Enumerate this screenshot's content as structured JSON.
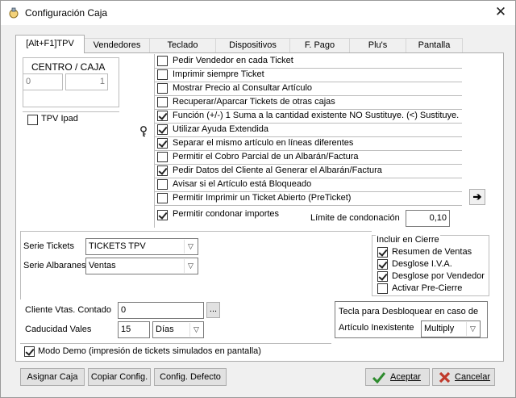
{
  "window": {
    "title": "Configuración Caja",
    "close_glyph": "✕"
  },
  "tabs": [
    "[Alt+F1]TPV",
    "Vendedores",
    "Teclado",
    "Dispositivos",
    "F. Pago",
    "Plu's",
    "Pantalla"
  ],
  "centro_caja": {
    "label": "CENTRO / CAJA",
    "centro_value": "0",
    "caja_value": "1"
  },
  "tpv_ipad": {
    "label": "TPV Ipad",
    "checked": false
  },
  "help_icon": "key-help-icon",
  "options": [
    {
      "label": "Pedir Vendedor en cada Ticket",
      "checked": false
    },
    {
      "label": "Imprimir siempre Ticket",
      "checked": false
    },
    {
      "label": "Mostrar Precio al Consultar Artículo",
      "checked": false
    },
    {
      "label": "Recuperar/Aparcar Tickets de otras cajas",
      "checked": false
    },
    {
      "label": "Función (+/-) 1 Suma a la cantidad existente NO Sustituye. (<) Sustituye.",
      "checked": true
    },
    {
      "label": "Utilizar Ayuda Extendida",
      "checked": true
    },
    {
      "label": "Separar el mismo artículo en líneas diferentes",
      "checked": true
    },
    {
      "label": "Permitir el Cobro Parcial de un Albarán/Factura",
      "checked": false
    },
    {
      "label": "Pedir Datos del Cliente al Generar el Albarán/Factura",
      "checked": true
    },
    {
      "label": "Avisar si el Artículo está Bloqueado",
      "checked": false
    },
    {
      "label": "Permitir Imprimir un Ticket Abierto (PreTicket)",
      "checked": false
    },
    {
      "label": "Permitir condonar importes",
      "checked": true
    }
  ],
  "condonacion": {
    "label": "Límite de condonación",
    "value": "0,10"
  },
  "arrow_button": "➔",
  "series": {
    "tickets_label": "Serie Tickets",
    "tickets_value": "TICKETS TPV",
    "albaranes_label": "Serie Albaranes",
    "albaranes_value": "Ventas"
  },
  "incluir_cierre": {
    "title": "Incluir en Cierre",
    "items": [
      {
        "label": "Resumen de Ventas",
        "checked": true
      },
      {
        "label": "Desglose I.V.A.",
        "checked": true
      },
      {
        "label": "Desglose por Vendedor",
        "checked": true
      },
      {
        "label": "Activar Pre-Cierre",
        "checked": false
      }
    ]
  },
  "cliente": {
    "label": "Cliente Vtas. Contado",
    "value": "0",
    "browse": "..."
  },
  "caducidad": {
    "label": "Caducidad Vales",
    "value": "15",
    "unit": "Días"
  },
  "tecla": {
    "line1": "Tecla para Desbloquear en caso de",
    "line2": "Artículo Inexistente",
    "value": "Multiply"
  },
  "modo_demo": {
    "label": "Modo Demo (impresión de tickets simulados en pantalla)",
    "checked": true
  },
  "buttons": {
    "asignar": "Asignar Caja",
    "copiar": "Copiar Config.",
    "defecto": "Config. Defecto",
    "aceptar": "Aceptar",
    "cancelar": "Cancelar"
  },
  "colors": {
    "accept_check": "#2e8b2e",
    "cancel_x": "#c0392b"
  }
}
